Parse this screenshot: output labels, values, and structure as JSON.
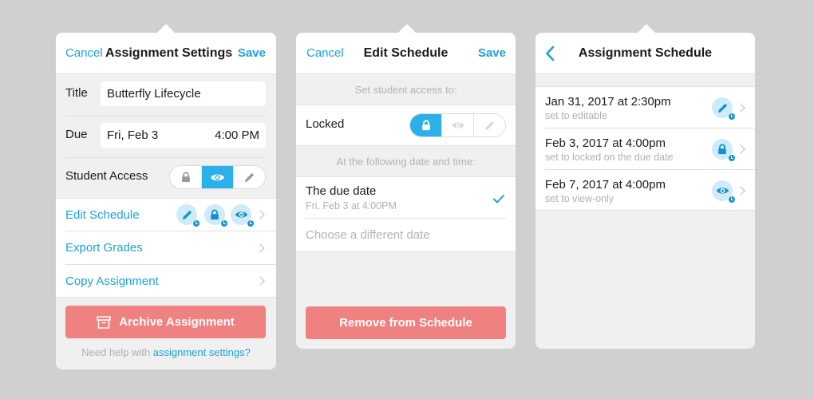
{
  "colors": {
    "accent": "#1ea1da",
    "segment_active": "#2bb0ea",
    "danger_button": "#ef8181",
    "badge_bg": "#cdebf9",
    "background": "#d0d0d0"
  },
  "settings_panel": {
    "header": {
      "cancel": "Cancel",
      "title": "Assignment Settings",
      "save": "Save"
    },
    "title_label": "Title",
    "title_value": "Butterfly Lifecycle",
    "due_label": "Due",
    "due_date": "Fri, Feb 3",
    "due_time": "4:00 PM",
    "access_label": "Student Access",
    "access_options": [
      "lock-icon",
      "eye-icon",
      "pencil-icon"
    ],
    "access_selected": "view-only",
    "menu": [
      {
        "label": "Edit Schedule",
        "icons": [
          "pencil-icon",
          "lock-icon",
          "eye-icon"
        ]
      },
      {
        "label": "Export Grades"
      },
      {
        "label": "Copy Assignment"
      }
    ],
    "archive_button": "Archive Assignment",
    "help_prefix": "Need help with ",
    "help_link": "assignment settings?"
  },
  "edit_schedule_panel": {
    "header": {
      "cancel": "Cancel",
      "title": "Edit Schedule",
      "save": "Save"
    },
    "access_caption": "Set student access to:",
    "access_label": "Locked",
    "access_selected": "locked",
    "date_caption": "At the following date and time:",
    "options": [
      {
        "label": "The due date",
        "sub": "Fri, Feb 3 at 4:00PM",
        "checked": true
      },
      {
        "label": "Choose a different date",
        "checked": false
      }
    ],
    "remove_button": "Remove from Schedule"
  },
  "schedule_panel": {
    "header": {
      "back": "back-chevron-icon",
      "title": "Assignment Schedule"
    },
    "items": [
      {
        "date": "Jan 31, 2017 at 2:30pm",
        "sub": "set to editable",
        "icon": "pencil-icon"
      },
      {
        "date": "Feb 3, 2017 at 4:00pm",
        "sub": "set to locked on the due date",
        "icon": "lock-icon"
      },
      {
        "date": "Feb 7, 2017 at 4:00pm",
        "sub": "set to view-only",
        "icon": "eye-icon"
      }
    ]
  }
}
